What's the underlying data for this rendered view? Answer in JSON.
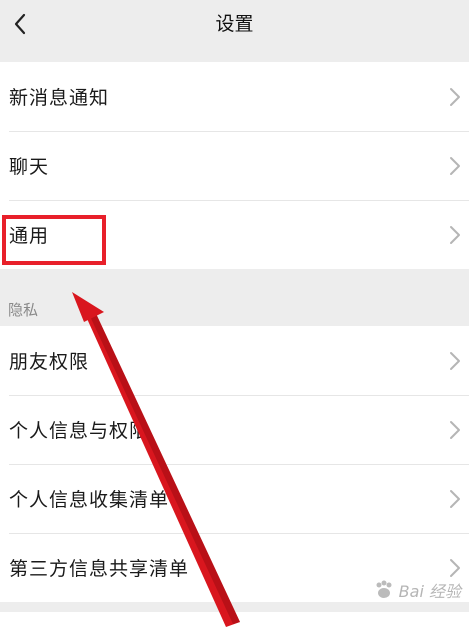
{
  "header": {
    "title": "设置",
    "back_icon": "chevron-left-icon"
  },
  "group_main": [
    {
      "label": "新消息通知"
    },
    {
      "label": "聊天"
    },
    {
      "label": "通用"
    }
  ],
  "privacy": {
    "header": "隐私",
    "items": [
      {
        "label": "朋友权限"
      },
      {
        "label": "个人信息与权限"
      },
      {
        "label": "个人信息收集清单"
      },
      {
        "label": "第三方信息共享清单"
      }
    ]
  },
  "annotation": {
    "highlight_color": "#e8202a",
    "arrow_color": "#d9161e"
  },
  "watermark": {
    "text": "Bai 经验"
  },
  "colors": {
    "background": "#ededed",
    "row_background": "#ffffff",
    "text": "#1a1a1a",
    "section_text": "#8a8a8a",
    "chevron": "#b5b5b5"
  }
}
